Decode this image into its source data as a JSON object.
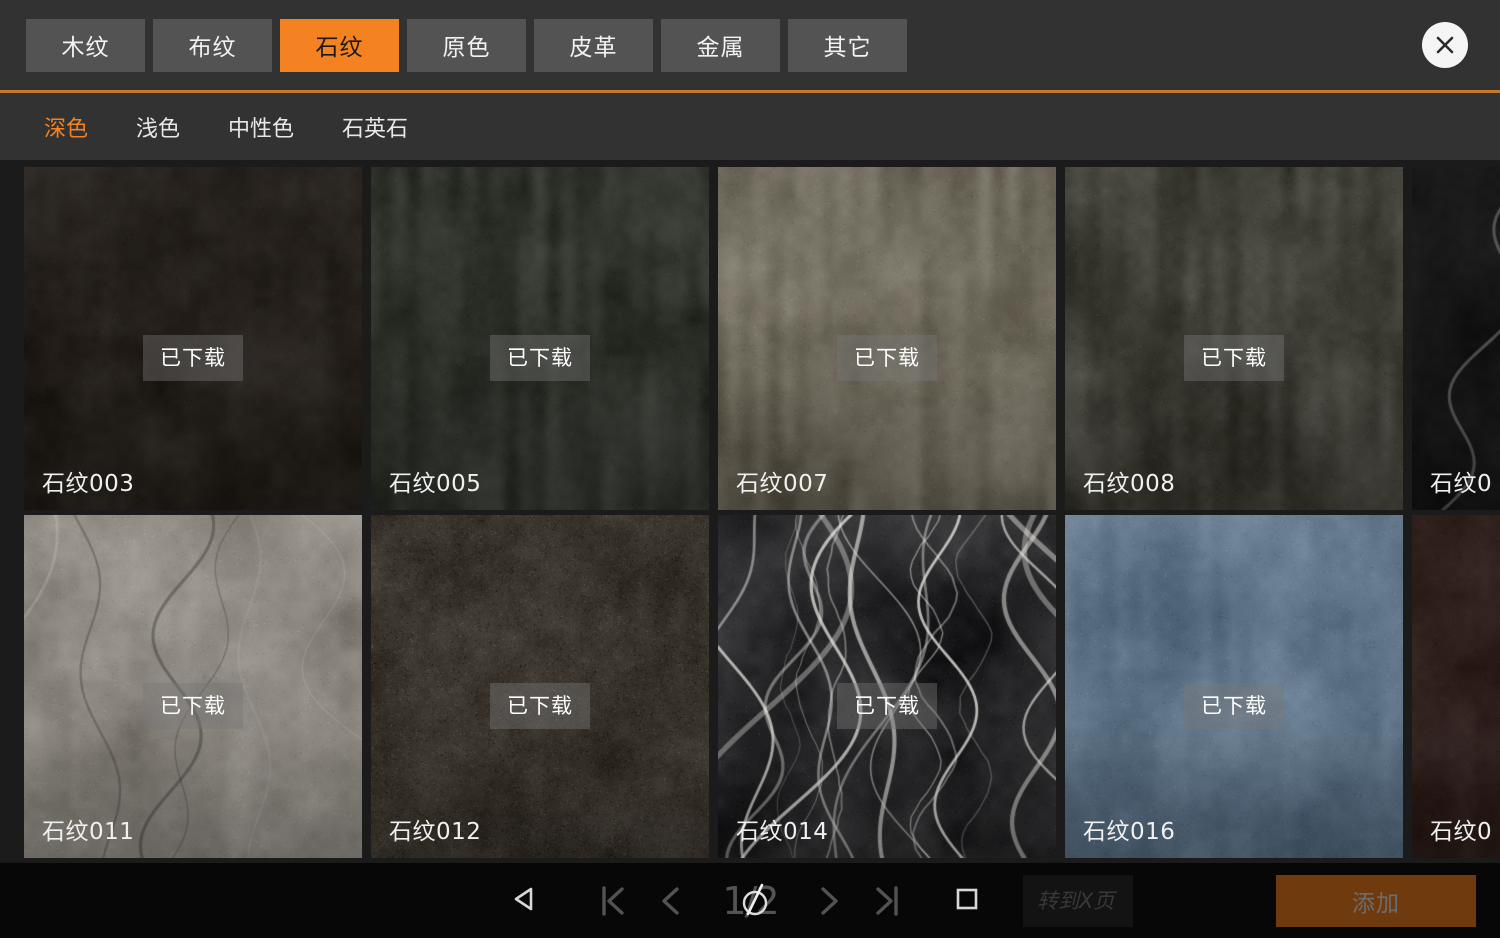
{
  "header": {
    "category_tabs": [
      {
        "label": "木纹",
        "active": false
      },
      {
        "label": "布纹",
        "active": false
      },
      {
        "label": "石纹",
        "active": true
      },
      {
        "label": "原色",
        "active": false
      },
      {
        "label": "皮革",
        "active": false
      },
      {
        "label": "金属",
        "active": false
      },
      {
        "label": "其它",
        "active": false
      }
    ],
    "close_icon": "close-icon",
    "accent_color": "#F58220",
    "rule_color": "#C4792A",
    "bar_color": "#333232"
  },
  "subtabs": [
    {
      "label": "深色",
      "active": true
    },
    {
      "label": "浅色",
      "active": false
    },
    {
      "label": "中性色",
      "active": false
    },
    {
      "label": "石英石",
      "active": false
    }
  ],
  "grid": {
    "badge_label": "已下载",
    "rows": [
      [
        {
          "name": "石纹003",
          "badge": "已下载",
          "tone": "dark-brown-slate",
          "base": "#241f1a",
          "partial": false
        },
        {
          "name": "石纹005",
          "badge": "已下载",
          "tone": "dark-green-concrete",
          "base": "#2d3029",
          "partial": false
        },
        {
          "name": "石纹007",
          "badge": "已下载",
          "tone": "olive-gray-concrete",
          "base": "#6b6658",
          "partial": false
        },
        {
          "name": "石纹008",
          "badge": "已下载",
          "tone": "charcoal-concrete",
          "base": "#3a3a33",
          "partial": false
        },
        {
          "name": "石纹0",
          "badge": "",
          "tone": "black-marble",
          "base": "#141414",
          "partial": true
        }
      ],
      [
        {
          "name": "石纹011",
          "badge": "已下载",
          "tone": "light-gray-marble",
          "base": "#8e8880",
          "partial": false
        },
        {
          "name": "石纹012",
          "badge": "已下载",
          "tone": "dark-speckled-granite",
          "base": "#3b352f",
          "partial": false
        },
        {
          "name": "石纹014",
          "badge": "已下载",
          "tone": "black-white-marble",
          "base": "#222224",
          "partial": false
        },
        {
          "name": "石纹016",
          "badge": "已下载",
          "tone": "blue-gray-concrete",
          "base": "#5d7285",
          "partial": false
        },
        {
          "name": "石纹0",
          "badge": "",
          "tone": "dark-red-stone",
          "base": "#2a1b1a",
          "partial": true
        }
      ]
    ]
  },
  "bottombar": {
    "back_icon": "back-triangle-icon",
    "first_page_icon": "first-page-icon",
    "prev_page_icon": "prev-page-icon",
    "page_indicator": "1/2",
    "next_page_icon": "next-page-icon",
    "last_page_icon": "last-page-icon",
    "recents_icon": "square-recents-icon",
    "home_icon": "home-circle-icon",
    "goto_placeholder": "转到X页",
    "goto_value": "",
    "add_label": "添加"
  }
}
